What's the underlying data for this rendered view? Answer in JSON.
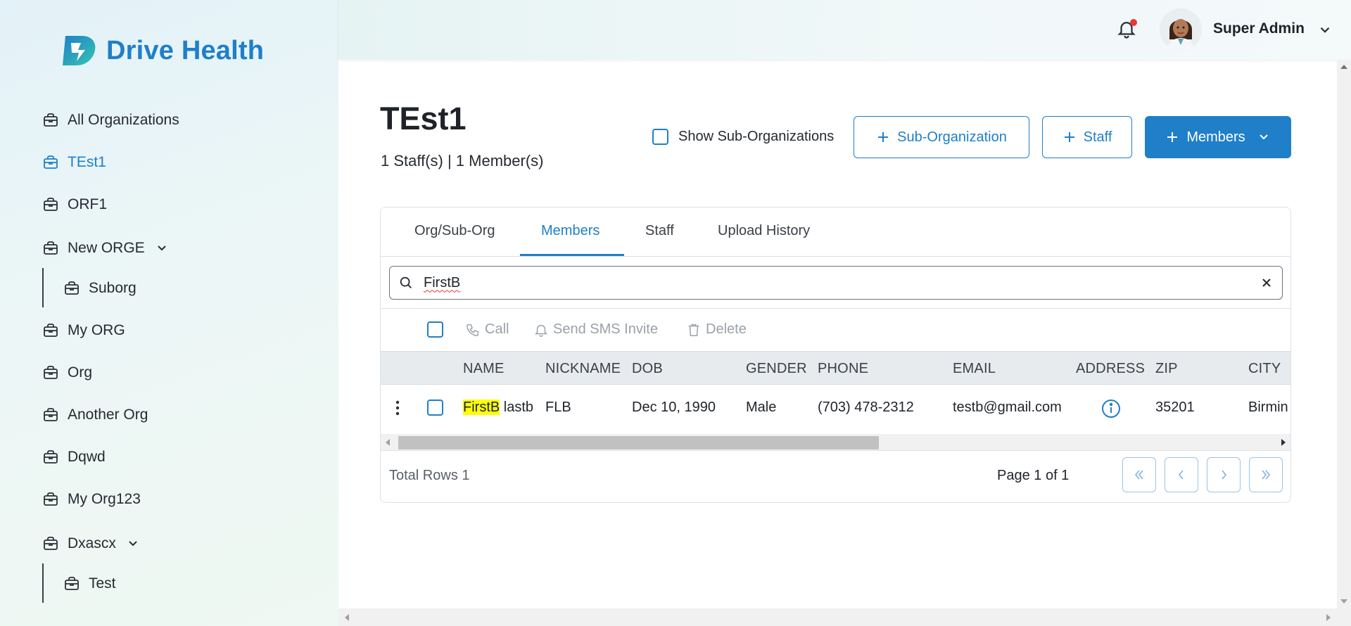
{
  "brand": {
    "name": "Drive Health",
    "colors": {
      "accent": "#1f7fc9",
      "highlight": "#ffff00"
    }
  },
  "sidebar": {
    "items": [
      {
        "label": "All Organizations",
        "icon": "briefcase-icon"
      },
      {
        "label": "TEst1",
        "icon": "briefcase-icon",
        "active": true
      },
      {
        "label": "ORF1",
        "icon": "briefcase-icon"
      },
      {
        "label": "New ORGE",
        "icon": "briefcase-icon",
        "expandable": true
      },
      {
        "label": "Suborg",
        "icon": "briefcase-icon",
        "child": true
      },
      {
        "label": "My ORG",
        "icon": "briefcase-icon"
      },
      {
        "label": "Org",
        "icon": "briefcase-icon"
      },
      {
        "label": "Another Org",
        "icon": "briefcase-icon"
      },
      {
        "label": "Dqwd",
        "icon": "briefcase-icon"
      },
      {
        "label": "My Org123",
        "icon": "briefcase-icon"
      },
      {
        "label": "Dxascx",
        "icon": "briefcase-icon",
        "expandable": true
      },
      {
        "label": "Test",
        "icon": "briefcase-icon",
        "child": true
      }
    ]
  },
  "topbar": {
    "user_name": "Super Admin",
    "notifications_icon": "bell-icon"
  },
  "header": {
    "title": "TEst1",
    "subtitle": "1 Staff(s) | 1 Member(s)",
    "show_sub_label": "Show Sub-Organizations",
    "buttons": {
      "sub_org": "Sub-Organization",
      "staff": "Staff",
      "members": "Members"
    }
  },
  "tabs": [
    {
      "label": "Org/Sub-Org"
    },
    {
      "label": "Members",
      "active": true
    },
    {
      "label": "Staff"
    },
    {
      "label": "Upload History"
    }
  ],
  "search": {
    "value": "FirstB"
  },
  "actions": {
    "call": "Call",
    "sms": "Send SMS Invite",
    "delete": "Delete"
  },
  "table": {
    "columns": [
      "NAME",
      "NICKNAME",
      "DOB",
      "GENDER",
      "PHONE",
      "EMAIL",
      "ADDRESS",
      "ZIP",
      "CITY"
    ],
    "rows": [
      {
        "name_highlight": "FirstB",
        "name_rest": "lastb",
        "nickname": "FLB",
        "dob": "Dec 10, 1990",
        "gender": "Male",
        "phone": "(703) 478-2312",
        "email": "testb@gmail.com",
        "address_icon": "info-icon",
        "zip": "35201",
        "city": "Birmin"
      }
    ]
  },
  "footer": {
    "total_rows": "Total Rows 1",
    "page_info": "Page 1 of 1"
  }
}
